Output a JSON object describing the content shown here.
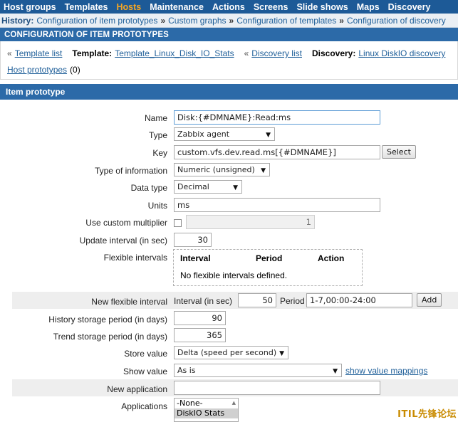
{
  "topnav": {
    "items": [
      "Host groups",
      "Templates",
      "Hosts",
      "Maintenance",
      "Actions",
      "Screens",
      "Slide shows",
      "Maps",
      "Discovery"
    ],
    "active": "Hosts"
  },
  "breadcrumbs": {
    "label": "History:",
    "items": [
      "Configuration of item prototypes",
      "Custom graphs",
      "Configuration of templates",
      "Configuration of discovery"
    ]
  },
  "page_title": "CONFIGURATION OF ITEM PROTOTYPES",
  "context": {
    "template_list_link": "Template list",
    "template_label": "Template:",
    "template_value": "Template_Linux_Disk_IO_Stats",
    "discovery_list_link": "Discovery list",
    "discovery_label": "Discovery:",
    "discovery_value": "Linux DiskIO discovery",
    "host_prototypes_link": "Host prototypes",
    "host_prototypes_count": "(0)"
  },
  "section_title": "Item prototype",
  "form": {
    "name": {
      "label": "Name",
      "value": "Disk:{#DMNAME}:Read:ms"
    },
    "type": {
      "label": "Type",
      "value": "Zabbix agent"
    },
    "key": {
      "label": "Key",
      "value": "custom.vfs.dev.read.ms[{#DMNAME}]",
      "button": "Select"
    },
    "type_of_information": {
      "label": "Type of information",
      "value": "Numeric (unsigned)"
    },
    "data_type": {
      "label": "Data type",
      "value": "Decimal"
    },
    "units": {
      "label": "Units",
      "value": "ms"
    },
    "custom_multiplier": {
      "label": "Use custom multiplier",
      "value": "1"
    },
    "update_interval": {
      "label": "Update interval (in sec)",
      "value": "30"
    },
    "flexible_intervals": {
      "label": "Flexible intervals",
      "columns": [
        "Interval",
        "Period",
        "Action"
      ],
      "empty_text": "No flexible intervals defined."
    },
    "new_flexible_interval": {
      "label": "New flexible interval",
      "interval_label": "Interval (in sec)",
      "interval_value": "50",
      "period_label": "Period",
      "period_value": "1-7,00:00-24:00",
      "button": "Add"
    },
    "history": {
      "label": "History storage period (in days)",
      "value": "90"
    },
    "trends": {
      "label": "Trend storage period (in days)",
      "value": "365"
    },
    "store_value": {
      "label": "Store value",
      "value": "Delta (speed per second)"
    },
    "show_value": {
      "label": "Show value",
      "value": "As is",
      "link": "show value mappings"
    },
    "new_application": {
      "label": "New application",
      "value": ""
    },
    "applications": {
      "label": "Applications",
      "options": [
        "-None-",
        "DiskIO Stats"
      ],
      "selected": "DiskIO Stats"
    }
  },
  "watermark": "ITIL先锋论坛",
  "colors": {
    "nav_bg": "#1d5a97",
    "nav_active": "#f5a623",
    "header_bg": "#2c6aa8",
    "link": "#1f5f99"
  }
}
